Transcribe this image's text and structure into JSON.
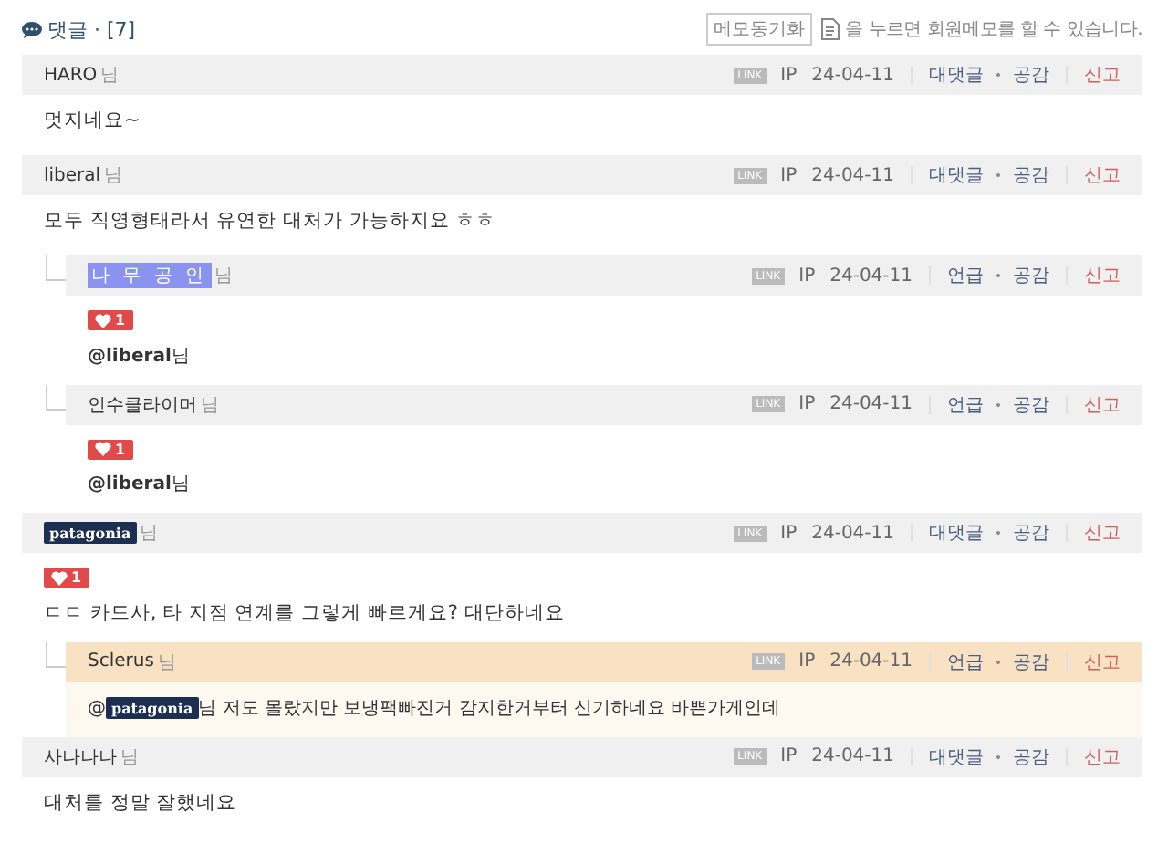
{
  "header": {
    "title": "댓글 · [7]",
    "memo_button": "메모동기화",
    "memo_hint": "을 누르면 회원메모를 할 수 있습니다."
  },
  "comments": [
    {
      "author": {
        "kind": "text",
        "name": "HARO"
      },
      "suffix": "님",
      "link": "LINK",
      "ip": "IP",
      "date": "24-04-11",
      "actions": [
        "대댓글",
        "공감"
      ],
      "report": "신고",
      "body": "멋지네요~",
      "highlighted": false
    },
    {
      "author": {
        "kind": "text",
        "name": "liberal"
      },
      "suffix": "님",
      "link": "LINK",
      "ip": "IP",
      "date": "24-04-11",
      "actions": [
        "대댓글",
        "공감"
      ],
      "report": "신고",
      "body": "모두 직영형태라서 유연한 대처가 가능하지요 ㅎㅎ",
      "highlighted": false,
      "children": [
        {
          "author": {
            "kind": "highlight",
            "name": "나 무 공 인"
          },
          "suffix": "님",
          "link": "LINK",
          "ip": "IP",
          "date": "24-04-11",
          "actions": [
            "언급",
            "공감"
          ],
          "report": "신고",
          "likes": "1",
          "body": "**@liberal**님",
          "highlighted": false
        },
        {
          "author": {
            "kind": "text",
            "name": "인수클라이머"
          },
          "suffix": "님",
          "link": "LINK",
          "ip": "IP",
          "date": "24-04-11",
          "actions": [
            "언급",
            "공감"
          ],
          "report": "신고",
          "likes": "1",
          "body": "**@liberal**님",
          "highlighted": false
        }
      ]
    },
    {
      "author": {
        "kind": "logo",
        "name": "patagonia"
      },
      "suffix": "님",
      "link": "LINK",
      "ip": "IP",
      "date": "24-04-11",
      "actions": [
        "대댓글",
        "공감"
      ],
      "report": "신고",
      "likes": "1",
      "body": "ㄷㄷ 카드사, 타 지점 연계를 그렇게 빠르게요? 대단하네요",
      "highlighted": false,
      "children": [
        {
          "author": {
            "kind": "text",
            "name": "Sclerus"
          },
          "suffix": "님",
          "link": "LINK",
          "ip": "IP",
          "date": "24-04-11",
          "actions": [
            "언급",
            "공감"
          ],
          "report": "신고",
          "highlighted": true,
          "body_parts": [
            {
              "kind": "text",
              "text": "@"
            },
            {
              "kind": "logo",
              "text": "patagonia"
            },
            {
              "kind": "text",
              "text": "님 저도 몰랐지만 보냉팩빠진거 감지한거부터 신기하네요 바쁜가게인데"
            }
          ]
        }
      ]
    },
    {
      "author": {
        "kind": "text",
        "name": "사나나나"
      },
      "suffix": "님",
      "link": "LINK",
      "ip": "IP",
      "date": "24-04-11",
      "actions": [
        "대댓글",
        "공감"
      ],
      "report": "신고",
      "body": "대처를 정말 잘했네요",
      "highlighted": false
    }
  ]
}
